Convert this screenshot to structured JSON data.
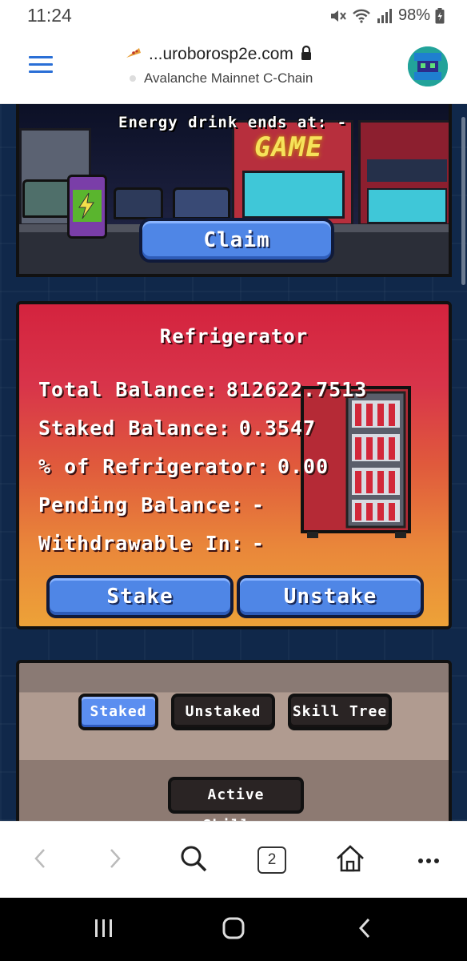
{
  "status_bar": {
    "time": "11:24",
    "battery": "98%",
    "icons": [
      "mute-icon",
      "wifi-icon",
      "signal-icon",
      "battery-icon"
    ]
  },
  "browser": {
    "url": "...uroborosp2e.com",
    "network": "Avalanche Mainnet C-Chain",
    "tab_count": "2"
  },
  "game": {
    "energy_text": "Energy drink ends at: -",
    "logo_text": "GAME",
    "claim_label": "Claim",
    "refrigerator": {
      "title": "Refrigerator",
      "stats": [
        {
          "label": "Total Balance:",
          "value": "812622.7513"
        },
        {
          "label": "Staked Balance:",
          "value": "0.3547"
        },
        {
          "label": "% of Refrigerator:",
          "value": "0.00"
        },
        {
          "label": "Pending Balance:",
          "value": "-"
        },
        {
          "label": "Withdrawable In:",
          "value": "-"
        }
      ],
      "stake_label": "Stake",
      "unstake_label": "Unstake"
    },
    "tabs": {
      "items": [
        "Staked",
        "Unstaked",
        "Skill Tree"
      ],
      "active": "Staked",
      "active_skills_label": "Active Skills:"
    }
  },
  "colors": {
    "accent_blue": "#4f86e6",
    "panel_red": "#d4233e",
    "panel_orange": "#eda238",
    "browser_blue": "#2a6fd6"
  }
}
